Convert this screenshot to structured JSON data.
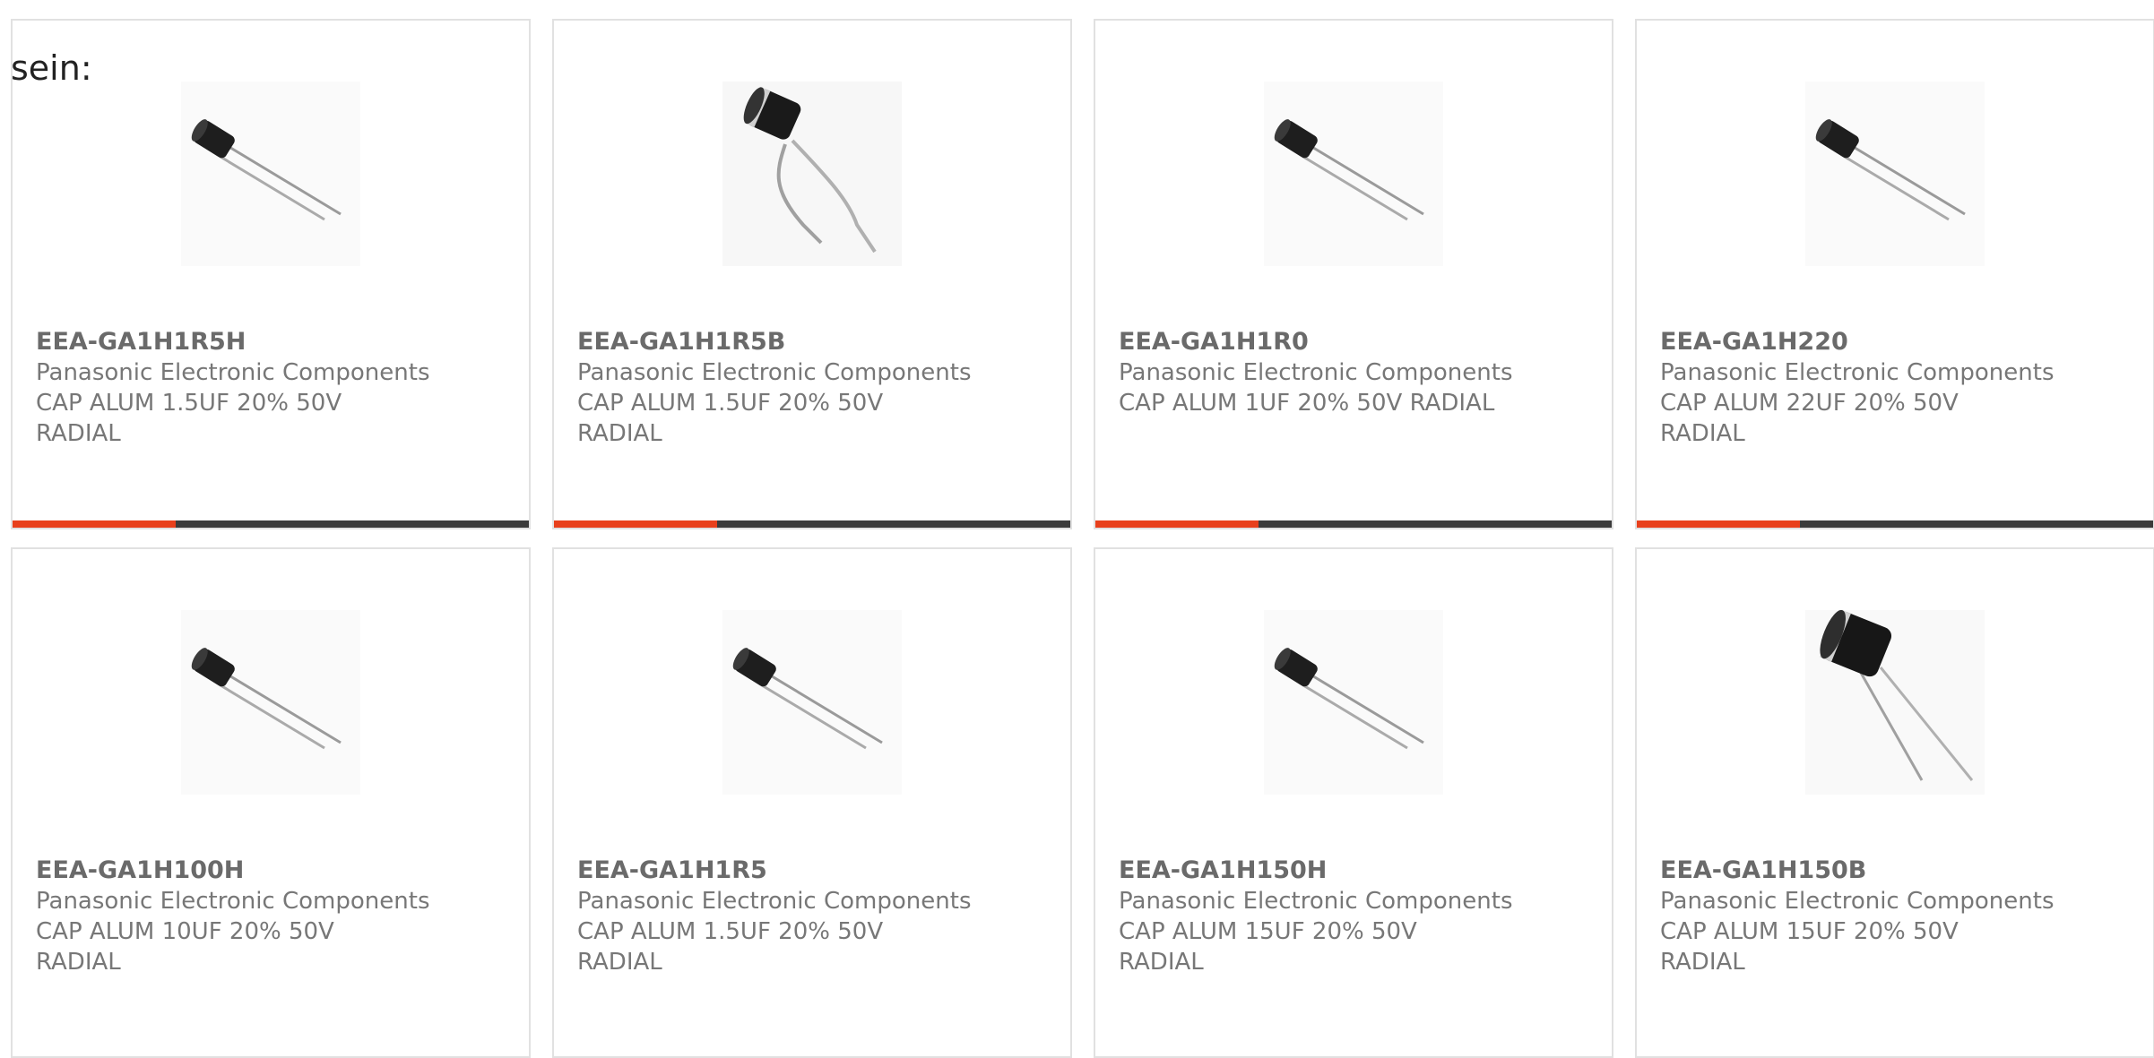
{
  "intro_text": "sein:",
  "colors": {
    "accent": "#e8401c",
    "bar": "#3b3b3b",
    "border": "#e1e1e1",
    "text": "#777777"
  },
  "products": [
    {
      "part": "EEA-GA1H1R5H",
      "manufacturer": "Panasonic Electronic Components",
      "description": "CAP ALUM 1.5UF 20% 50V RADIAL",
      "image": "capacitor-small-icon"
    },
    {
      "part": "EEA-GA1H1R5B",
      "manufacturer": "Panasonic Electronic Components",
      "description": "CAP ALUM 1.5UF 20% 50V RADIAL",
      "image": "capacitor-bent-leads-icon"
    },
    {
      "part": "EEA-GA1H1R0",
      "manufacturer": "Panasonic Electronic Components",
      "description": "CAP ALUM 1UF 20% 50V RADIAL",
      "image": "capacitor-small-icon"
    },
    {
      "part": "EEA-GA1H220",
      "manufacturer": "Panasonic Electronic Components",
      "description": "CAP ALUM 22UF 20% 50V RADIAL",
      "image": "capacitor-small-icon"
    },
    {
      "part": "EEA-GA1H100H",
      "manufacturer": "Panasonic Electronic Components",
      "description": "CAP ALUM 10UF 20% 50V RADIAL",
      "image": "capacitor-small-icon"
    },
    {
      "part": "EEA-GA1H1R5",
      "manufacturer": "Panasonic Electronic Components",
      "description": "CAP ALUM 1.5UF 20% 50V RADIAL",
      "image": "capacitor-small-icon"
    },
    {
      "part": "EEA-GA1H150H",
      "manufacturer": "Panasonic Electronic Components",
      "description": "CAP ALUM 15UF 20% 50V RADIAL",
      "image": "capacitor-small-icon"
    },
    {
      "part": "EEA-GA1H150B",
      "manufacturer": "Panasonic Electronic Components",
      "description": "CAP ALUM 15UF 20% 50V RADIAL",
      "image": "capacitor-large-icon"
    }
  ]
}
